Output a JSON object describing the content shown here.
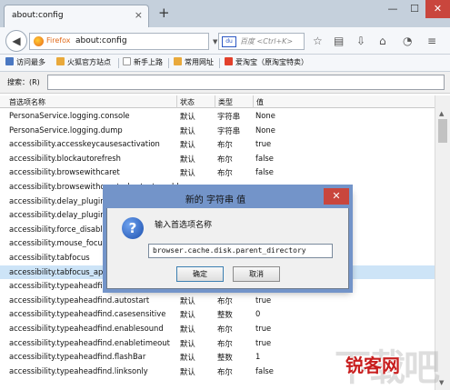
{
  "tab": {
    "title": "about:config",
    "close": "×"
  },
  "newtab": "+",
  "window": {
    "min": "—",
    "max": "☐",
    "close": "✕"
  },
  "navbar": {
    "back": "◀",
    "url_brand": "Firefox",
    "url": "about:config",
    "search_engine": "du",
    "search_placeholder": "百度 <Ctrl+K>",
    "icons": [
      "star-icon",
      "bookmark-list-icon",
      "download-icon",
      "home-icon",
      "chat-icon",
      "menu-icon"
    ]
  },
  "bookmarks": [
    {
      "label": "访问最多",
      "color": "#4a78c2"
    },
    {
      "label": "火狐官方站点",
      "color": "#e9a93b"
    },
    {
      "label": "新手上路",
      "color": "#ffffff"
    },
    {
      "label": "常用网址",
      "color": "#e9a93b"
    },
    {
      "label": "爱淘宝（原淘宝特卖）",
      "color": "#e2402b"
    }
  ],
  "search": {
    "label": "搜索：(R)",
    "value": ""
  },
  "columns": [
    "首选项名称",
    "状态",
    "类型",
    "值"
  ],
  "rows": [
    {
      "name": "PersonaService.logging.console",
      "status": "默认",
      "type": "字符串",
      "value": "None"
    },
    {
      "name": "PersonaService.logging.dump",
      "status": "默认",
      "type": "字符串",
      "value": "None"
    },
    {
      "name": "accessibility.accesskeycausesactivation",
      "status": "默认",
      "type": "布尔",
      "value": "true"
    },
    {
      "name": "accessibility.blockautorefresh",
      "status": "默认",
      "type": "布尔",
      "value": "false"
    },
    {
      "name": "accessibility.browsewithcaret",
      "status": "默认",
      "type": "布尔",
      "value": "false"
    },
    {
      "name": "accessibility.browsewithcaret_shortcut.enabled",
      "status": "",
      "type": "",
      "value": ""
    },
    {
      "name": "accessibility.delay_plugin_time",
      "status": "",
      "type": "",
      "value": ""
    },
    {
      "name": "accessibility.delay_plugins",
      "status": "",
      "type": "",
      "value": ""
    },
    {
      "name": "accessibility.force_disabled",
      "status": "",
      "type": "",
      "value": ""
    },
    {
      "name": "accessibility.mouse_focuses_formcontrol",
      "status": "",
      "type": "",
      "value": ""
    },
    {
      "name": "accessibility.tabfocus",
      "status": "",
      "type": "",
      "value": ""
    },
    {
      "name": "accessibility.tabfocus_applies_to_xul",
      "status": "",
      "type": "",
      "value": ""
    },
    {
      "name": "accessibility.typeaheadfind",
      "status": "默认",
      "type": "布尔",
      "value": "false"
    },
    {
      "name": "accessibility.typeaheadfind.autostart",
      "status": "默认",
      "type": "布尔",
      "value": "true"
    },
    {
      "name": "accessibility.typeaheadfind.casesensitive",
      "status": "默认",
      "type": "整数",
      "value": "0"
    },
    {
      "name": "accessibility.typeaheadfind.enablesound",
      "status": "默认",
      "type": "布尔",
      "value": "true"
    },
    {
      "name": "accessibility.typeaheadfind.enabletimeout",
      "status": "默认",
      "type": "布尔",
      "value": "true"
    },
    {
      "name": "accessibility.typeaheadfind.flashBar",
      "status": "默认",
      "type": "整数",
      "value": "1"
    },
    {
      "name": "accessibility.typeaheadfind.linksonly",
      "status": "默认",
      "type": "布尔",
      "value": "false"
    }
  ],
  "selected_row": 11,
  "dialog": {
    "title": "新的 字符串 值",
    "close": "✕",
    "icon": "?",
    "prompt": "输入首选项名称",
    "value": "browser.cache.disk.parent_directory",
    "ok": "确定",
    "cancel": "取消"
  },
  "watermark": {
    "main": "锐客网",
    "shadow": "下载吧"
  }
}
